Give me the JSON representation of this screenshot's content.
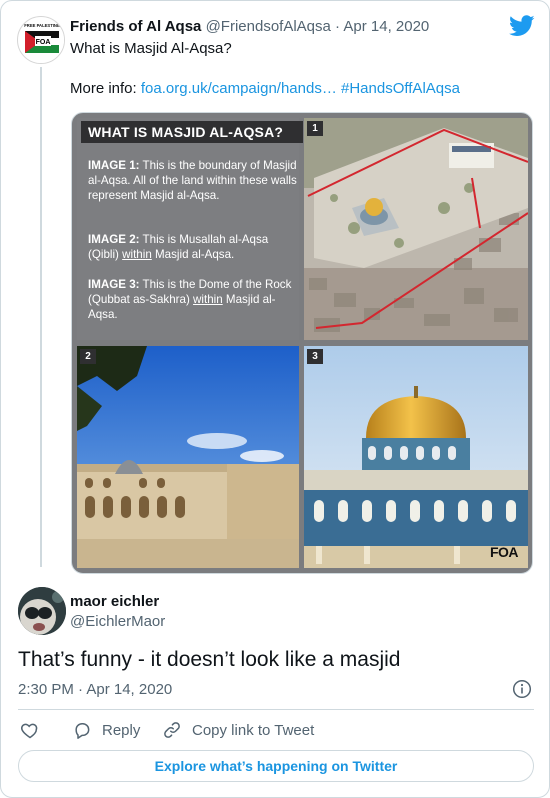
{
  "parent_tweet": {
    "author_name": "Friends of Al Aqsa",
    "author_handle": "@FriendsofAlAqsa",
    "separator": "·",
    "date": "Apr 14, 2020",
    "text": "What is Masjid Al-Aqsa?",
    "more_info_label": "More info: ",
    "link_text": "foa.org.uk/campaign/hands…",
    "hashtag": "#HandsOffAlAqsa",
    "avatar_badge": "FOA",
    "avatar_ring_text": "FREE PALESTINE",
    "infographic": {
      "title": "WHAT IS MASJID AL-AQSA?",
      "p1_bold": "IMAGE 1:",
      "p1_text": " This is the boundary of Masjid al-Aqsa. All of the land within these walls represent Masjid al-Aqsa.",
      "p2_bold": "IMAGE 2:",
      "p2_text_a": " This is Musallah al-Aqsa (Qibli) ",
      "p2_under": "within",
      "p2_text_b": " Masjid al-Aqsa.",
      "p3_bold": "IMAGE 3:",
      "p3_text_a": " This is the Dome of the Rock (Qubbat as-Sakhra) ",
      "p3_under": "within",
      "p3_text_b": " Masjid al-Aqsa.",
      "num1": "1",
      "num2": "2",
      "num3": "3",
      "watermark": "FOA"
    }
  },
  "reply_tweet": {
    "author_name": "maor eichler",
    "author_handle": "@EichlerMaor",
    "text": "That’s funny - it doesn’t look like a masjid",
    "timestamp": "2:30 PM · Apr 14, 2020"
  },
  "actions": {
    "reply_label": "Reply",
    "copy_label": "Copy link to Tweet"
  },
  "explore_label": "Explore what’s happening on Twitter",
  "colors": {
    "link": "#1b95e0",
    "secondary_text": "#536471",
    "border": "#cfd9de",
    "twitter_blue": "#1d9bf0"
  },
  "icons": [
    "twitter-bird-icon",
    "info-icon",
    "heart-icon",
    "reply-icon",
    "link-icon"
  ]
}
